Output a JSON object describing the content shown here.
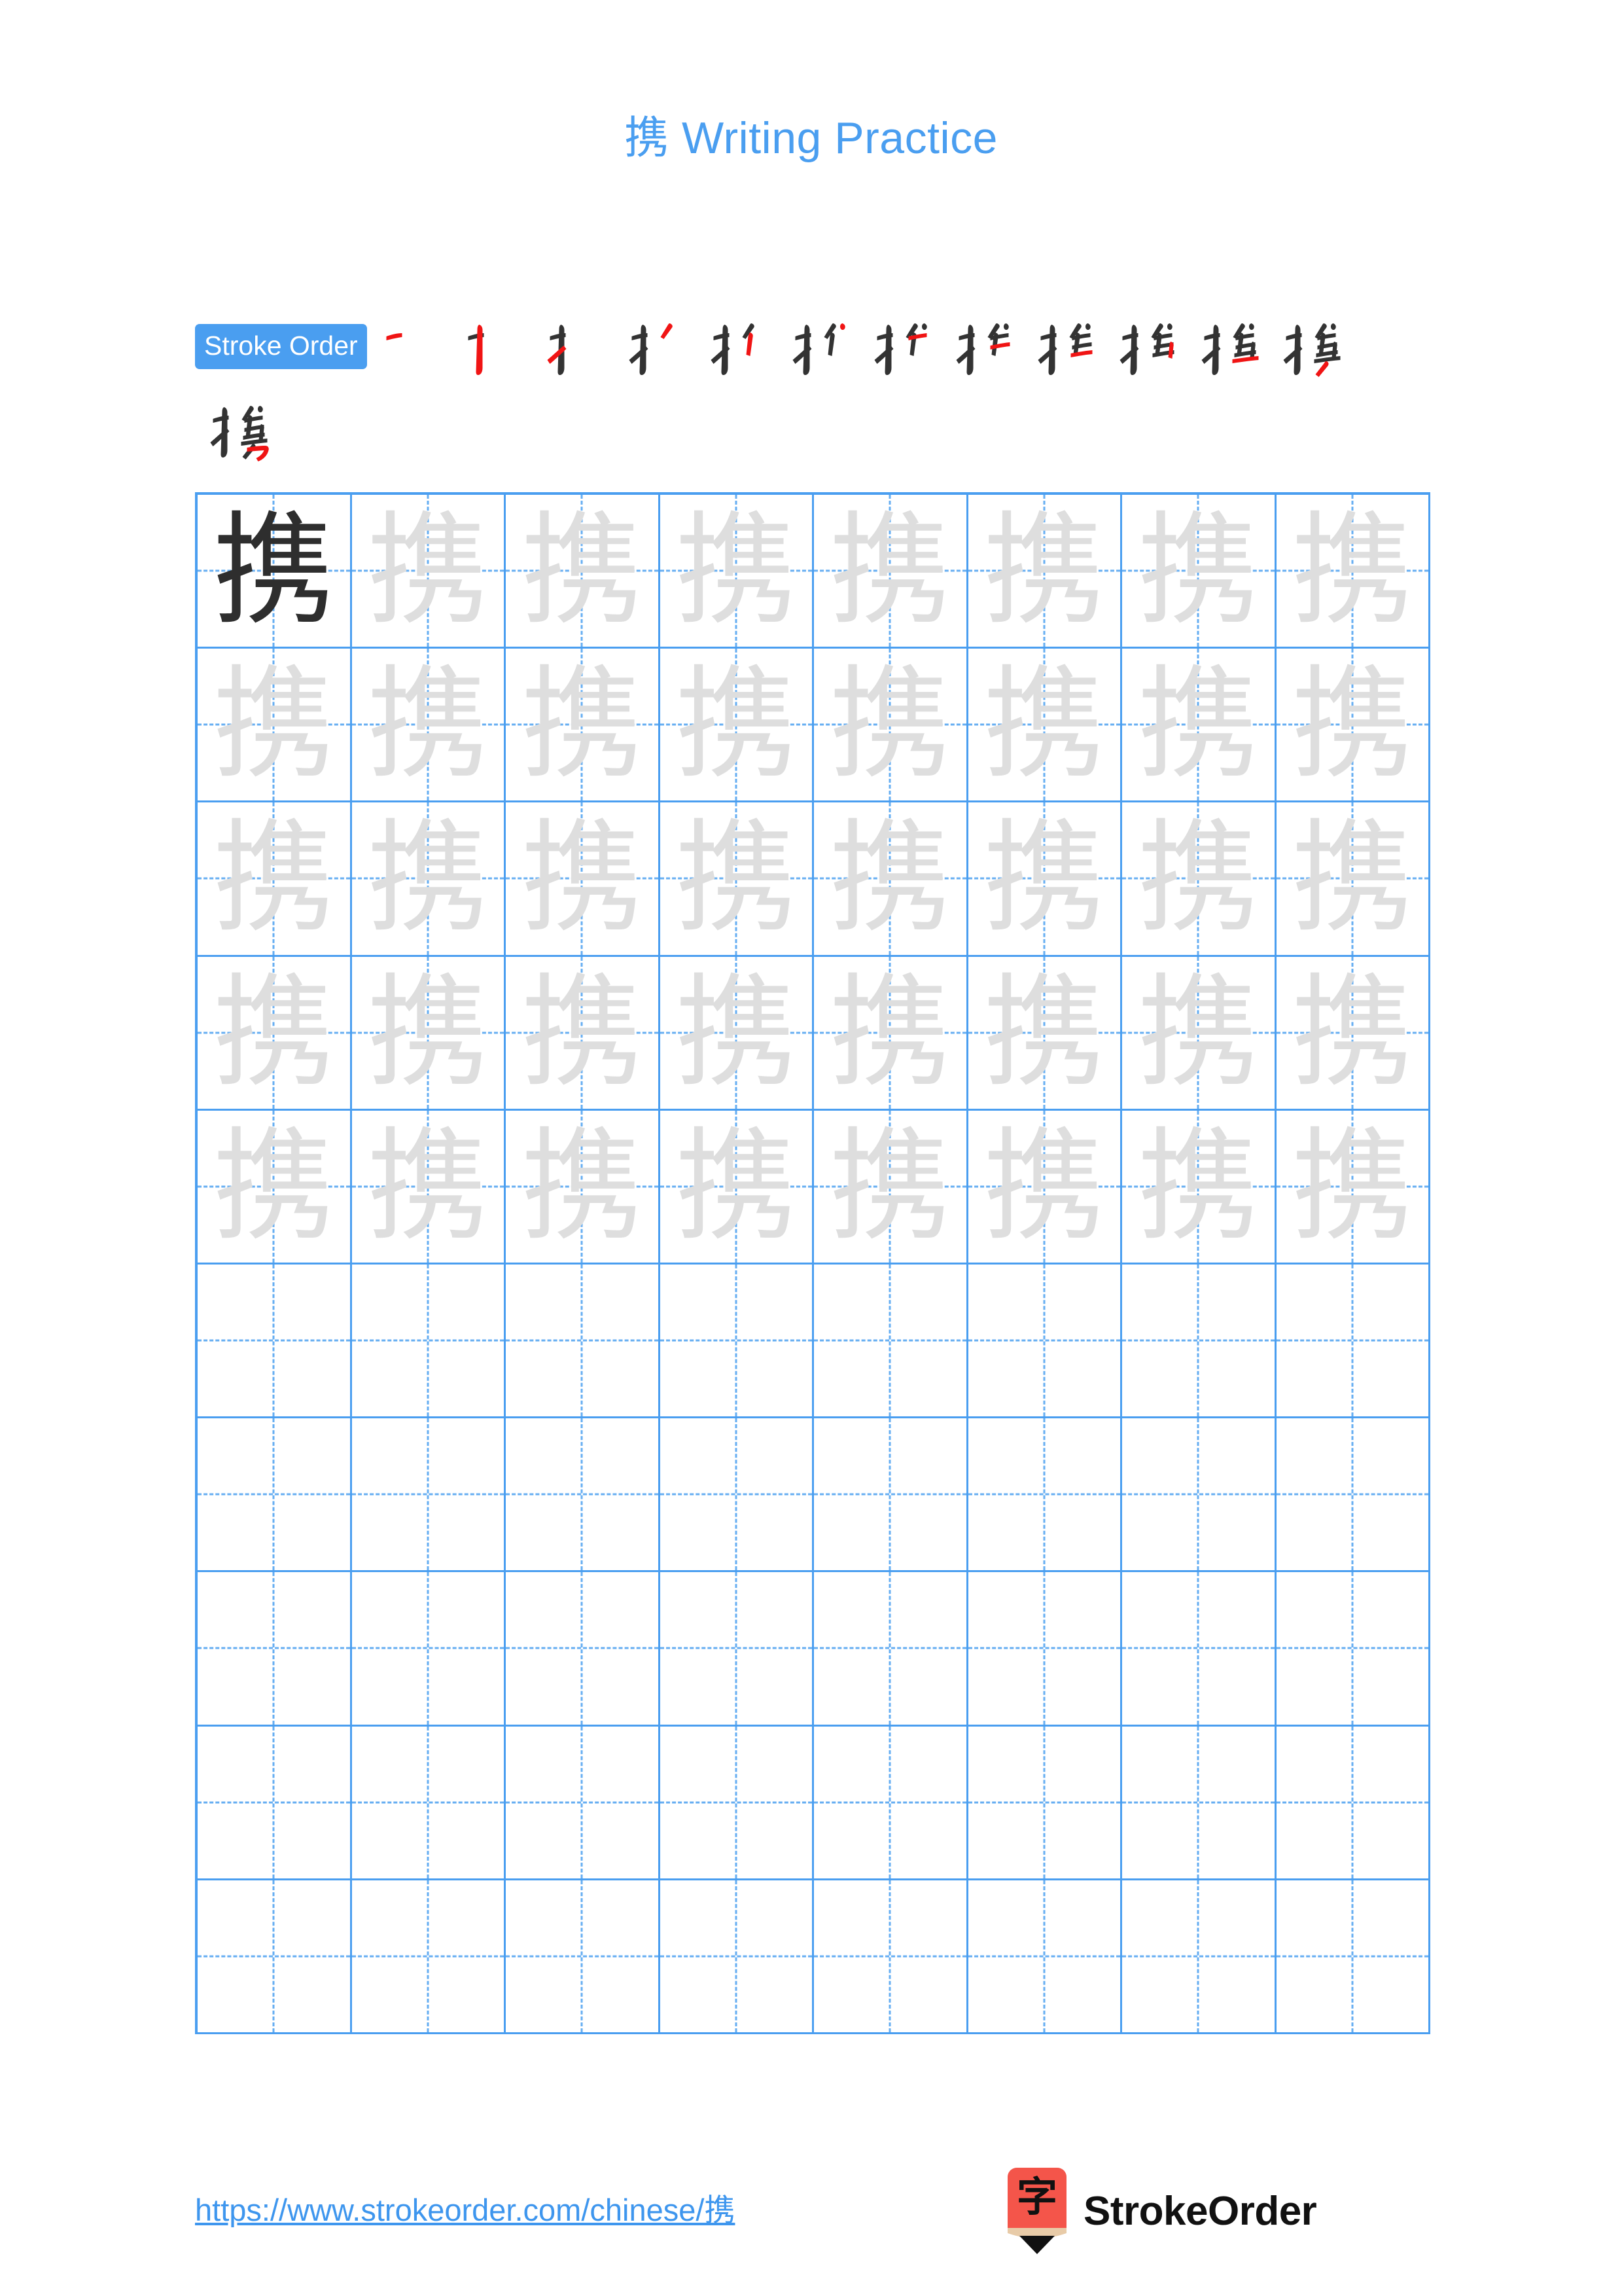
{
  "page": {
    "character": "携",
    "title_char": "携",
    "title_text": "Writing Practice",
    "background": "#ffffff",
    "accent_blue": "#4a9ef0",
    "ghost_gray": "#dedede",
    "ink_black": "#2e2e2e",
    "new_stroke_red": "#f01414"
  },
  "stroke_order": {
    "badge_label": "Stroke Order",
    "total_strokes": 13,
    "steps_row1": [
      {
        "index": 1,
        "label": "携 stroke 1"
      },
      {
        "index": 2,
        "label": "携 stroke 2"
      },
      {
        "index": 3,
        "label": "携 stroke 3"
      },
      {
        "index": 4,
        "label": "携 stroke 4"
      },
      {
        "index": 5,
        "label": "携 stroke 5"
      },
      {
        "index": 6,
        "label": "携 stroke 6"
      },
      {
        "index": 7,
        "label": "携 stroke 7"
      },
      {
        "index": 8,
        "label": "携 stroke 8"
      },
      {
        "index": 9,
        "label": "携 stroke 9"
      },
      {
        "index": 10,
        "label": "携 stroke 10"
      },
      {
        "index": 11,
        "label": "携 stroke 11"
      },
      {
        "index": 12,
        "label": "携 stroke 12"
      }
    ],
    "steps_row2": [
      {
        "index": 13,
        "label": "携 stroke 13"
      }
    ]
  },
  "grid": {
    "columns": 8,
    "rows": 10,
    "cells": [
      [
        "dark",
        "ghost",
        "ghost",
        "ghost",
        "ghost",
        "ghost",
        "ghost",
        "ghost"
      ],
      [
        "ghost",
        "ghost",
        "ghost",
        "ghost",
        "ghost",
        "ghost",
        "ghost",
        "ghost"
      ],
      [
        "ghost",
        "ghost",
        "ghost",
        "ghost",
        "ghost",
        "ghost",
        "ghost",
        "ghost"
      ],
      [
        "ghost",
        "ghost",
        "ghost",
        "ghost",
        "ghost",
        "ghost",
        "ghost",
        "ghost"
      ],
      [
        "ghost",
        "ghost",
        "ghost",
        "ghost",
        "ghost",
        "ghost",
        "ghost",
        "ghost"
      ],
      [
        "blank",
        "blank",
        "blank",
        "blank",
        "blank",
        "blank",
        "blank",
        "blank"
      ],
      [
        "blank",
        "blank",
        "blank",
        "blank",
        "blank",
        "blank",
        "blank",
        "blank"
      ],
      [
        "blank",
        "blank",
        "blank",
        "blank",
        "blank",
        "blank",
        "blank",
        "blank"
      ],
      [
        "blank",
        "blank",
        "blank",
        "blank",
        "blank",
        "blank",
        "blank",
        "blank"
      ],
      [
        "blank",
        "blank",
        "blank",
        "blank",
        "blank",
        "blank",
        "blank",
        "blank"
      ]
    ]
  },
  "footer": {
    "url": "https://www.strokeorder.com/chinese/携",
    "brand_name": "StrokeOrder",
    "logo_char": "字",
    "logo_body_color": "#f4554a",
    "logo_wood_color": "#e8cba8",
    "logo_tip_color": "#111111"
  }
}
